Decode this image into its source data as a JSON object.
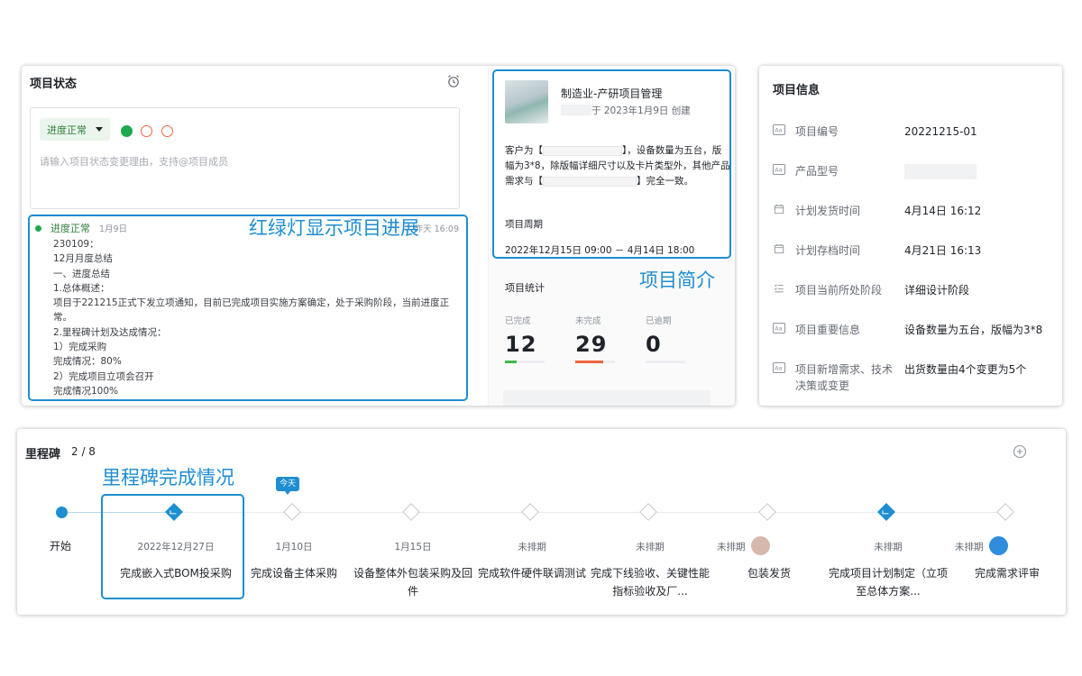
{
  "status": {
    "title": "项目状态",
    "selected_status": "进度正常",
    "placeholder": "请输入项目状态变更理由，支持@项目成员",
    "lights": [
      "green",
      "empty",
      "empty"
    ],
    "log": {
      "status": "进度正常",
      "date": "1月9日",
      "time": "昨天 16:09",
      "lines": [
        "230109：",
        "12月月度总结",
        "一、进度总结",
        "1.总体概述：",
        "项目于221215正式下发立项通知，目前已完成项目实施方案确定，处于采购阶段，当前进度正常。",
        "2.里程碑计划及达成情况：",
        "1）完成采购",
        "完成情况：80%",
        "2）完成项目立项会召开",
        "完成情况100%"
      ]
    },
    "callout": "红绿灯显示项目进展"
  },
  "intro": {
    "title": "制造业-产研项目管理",
    "created": "于 2023年1月9日 创建",
    "desc_part1": "客户为【",
    "desc_part2": "】，设备数量为五台，版幅为3*8，除版幅详细尺寸以及卡片类型外，其他产品需求与【",
    "desc_part3": "】完全一致。",
    "period_label": "项目周期",
    "period_value": "2022年12月15日 09:00 － 4月14日 18:00",
    "callout": "项目简介"
  },
  "stats": {
    "title": "项目统计",
    "items": [
      {
        "label": "已完成",
        "value": "12",
        "color": "#3fb950",
        "fill": 0.3
      },
      {
        "label": "未完成",
        "value": "29",
        "color": "#f0643f",
        "fill": 0.7
      },
      {
        "label": "已逾期",
        "value": "0",
        "color": "#f0b9b0",
        "fill": 0.0
      }
    ]
  },
  "info": {
    "title": "项目信息",
    "rows": [
      {
        "icon": "text-field-icon",
        "label": "项目编号",
        "value": "20221215-01"
      },
      {
        "icon": "text-field-icon",
        "label": "产品型号",
        "value": ""
      },
      {
        "icon": "calendar-icon",
        "label": "计划发货时间",
        "value": "4月14日 16:12"
      },
      {
        "icon": "calendar-icon",
        "label": "计划存档时间",
        "value": "4月21日 16:13"
      },
      {
        "icon": "list-icon",
        "label": "项目当前所处阶段",
        "value": "详细设计阶段"
      },
      {
        "icon": "text-field-icon",
        "label": "项目重要信息",
        "value": "设备数量为五台，版幅为3*8"
      },
      {
        "icon": "text-field-icon",
        "label": "项目新增需求、技术决策或变更",
        "value": "出货数量由4个变更为5个"
      }
    ]
  },
  "milestones": {
    "title": "里程碑",
    "count": "2 / 8",
    "callout": "里程碑完成情况",
    "today_label": "今天",
    "start_label": "开始",
    "items": [
      {
        "date": "2022年12月27日",
        "name": "完成嵌入式BOM投采购",
        "done": true,
        "avatar": ""
      },
      {
        "date": "1月10日",
        "name": "完成设备主体采购",
        "done": false,
        "avatar": ""
      },
      {
        "date": "1月15日",
        "name": "设备整体外包装采购及回件",
        "done": false,
        "avatar": ""
      },
      {
        "date": "未排期",
        "name": "完成软件硬件联调测试",
        "done": false,
        "avatar": ""
      },
      {
        "date": "未排期",
        "name": "完成下线验收、关键性能指标验收及厂...",
        "done": false,
        "avatar": ""
      },
      {
        "date": "未排期",
        "name": "包装发货",
        "done": false,
        "avatar": "#d6b8ac"
      },
      {
        "date": "未排期",
        "name": "完成项目计划制定（立项至总体方案...",
        "done": true,
        "avatar": ""
      },
      {
        "date": "未排期",
        "name": "完成需求评审",
        "done": false,
        "avatar": "#2f8ddc"
      }
    ]
  }
}
